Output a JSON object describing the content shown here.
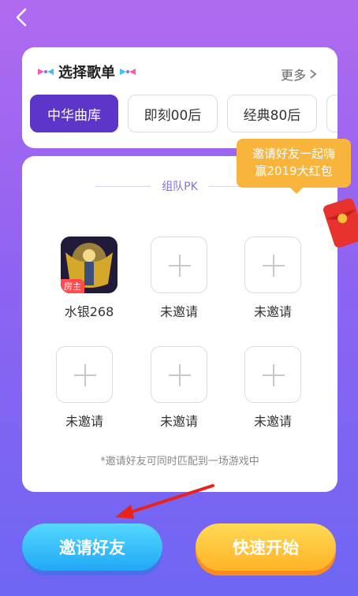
{
  "header": {
    "back_icon": "chevron-left-icon"
  },
  "song_select": {
    "title": "选择歌单",
    "more": "更多",
    "tabs": [
      {
        "label": "中华曲库",
        "active": true
      },
      {
        "label": "即刻00后",
        "active": false
      },
      {
        "label": "经典80后",
        "active": false
      }
    ]
  },
  "tooltip": {
    "line1": "邀请好友一起嗨",
    "line2": "赢2019大红包"
  },
  "team": {
    "title": "组队PK",
    "host": {
      "name": "水银268",
      "badge": "房主"
    },
    "slots": [
      {
        "label": "未邀请"
      },
      {
        "label": "未邀请"
      },
      {
        "label": "未邀请"
      },
      {
        "label": "未邀请"
      },
      {
        "label": "未邀请"
      }
    ],
    "note": "*邀请好友可同时匹配到一场游戏中"
  },
  "actions": {
    "invite": "邀请好友",
    "quick_start": "快速开始"
  },
  "colors": {
    "primary": "#5d35c9",
    "accent": "#f9b43c",
    "invite": "#21a8f5",
    "quick": "#ffb326"
  }
}
